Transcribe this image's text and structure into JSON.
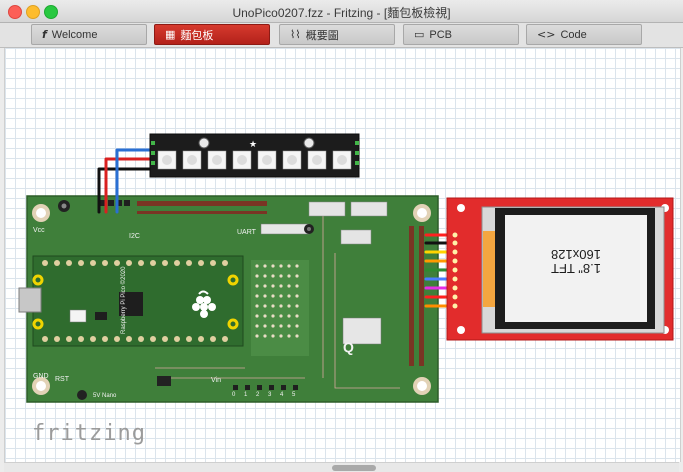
{
  "window": {
    "title": "UnoPico0207.fzz - Fritzing - [麵包板檢視]"
  },
  "tabs": [
    {
      "label": "Welcome",
      "icon": "fritzing-f-icon",
      "active": false
    },
    {
      "label": "麵包板",
      "icon": "breadboard-icon",
      "active": true
    },
    {
      "label": "概要圖",
      "icon": "schematic-icon",
      "active": false
    },
    {
      "label": "PCB",
      "icon": "pcb-icon",
      "active": false
    },
    {
      "label": "Code",
      "icon": "code-icon",
      "active": false
    }
  ],
  "canvas": {
    "watermark": "fritzing"
  },
  "parts": {
    "tft": {
      "label": "1.8\" TFT",
      "resolution": "160x128"
    },
    "carrier_board": {
      "vcc_label": "Vcc",
      "i2c_label": "I2C",
      "uart_label": "UART",
      "q_label": "Q",
      "rst_label": "RST",
      "gnd_label": "GND",
      "vin_label": "Vin",
      "nano_label": "5V Nano",
      "header_labels": [
        "0",
        "1",
        "2",
        "3",
        "4",
        "5"
      ]
    },
    "pico": {
      "label": "Raspberry Pi Pico ©2020"
    },
    "led_strip": {
      "leds": 8
    }
  },
  "colors": {
    "pcb_green": "#3f7f3a",
    "tab_active": "#c32a22",
    "tft_red": "#e22c2c",
    "led_strip_bg": "#1c1c1c"
  }
}
